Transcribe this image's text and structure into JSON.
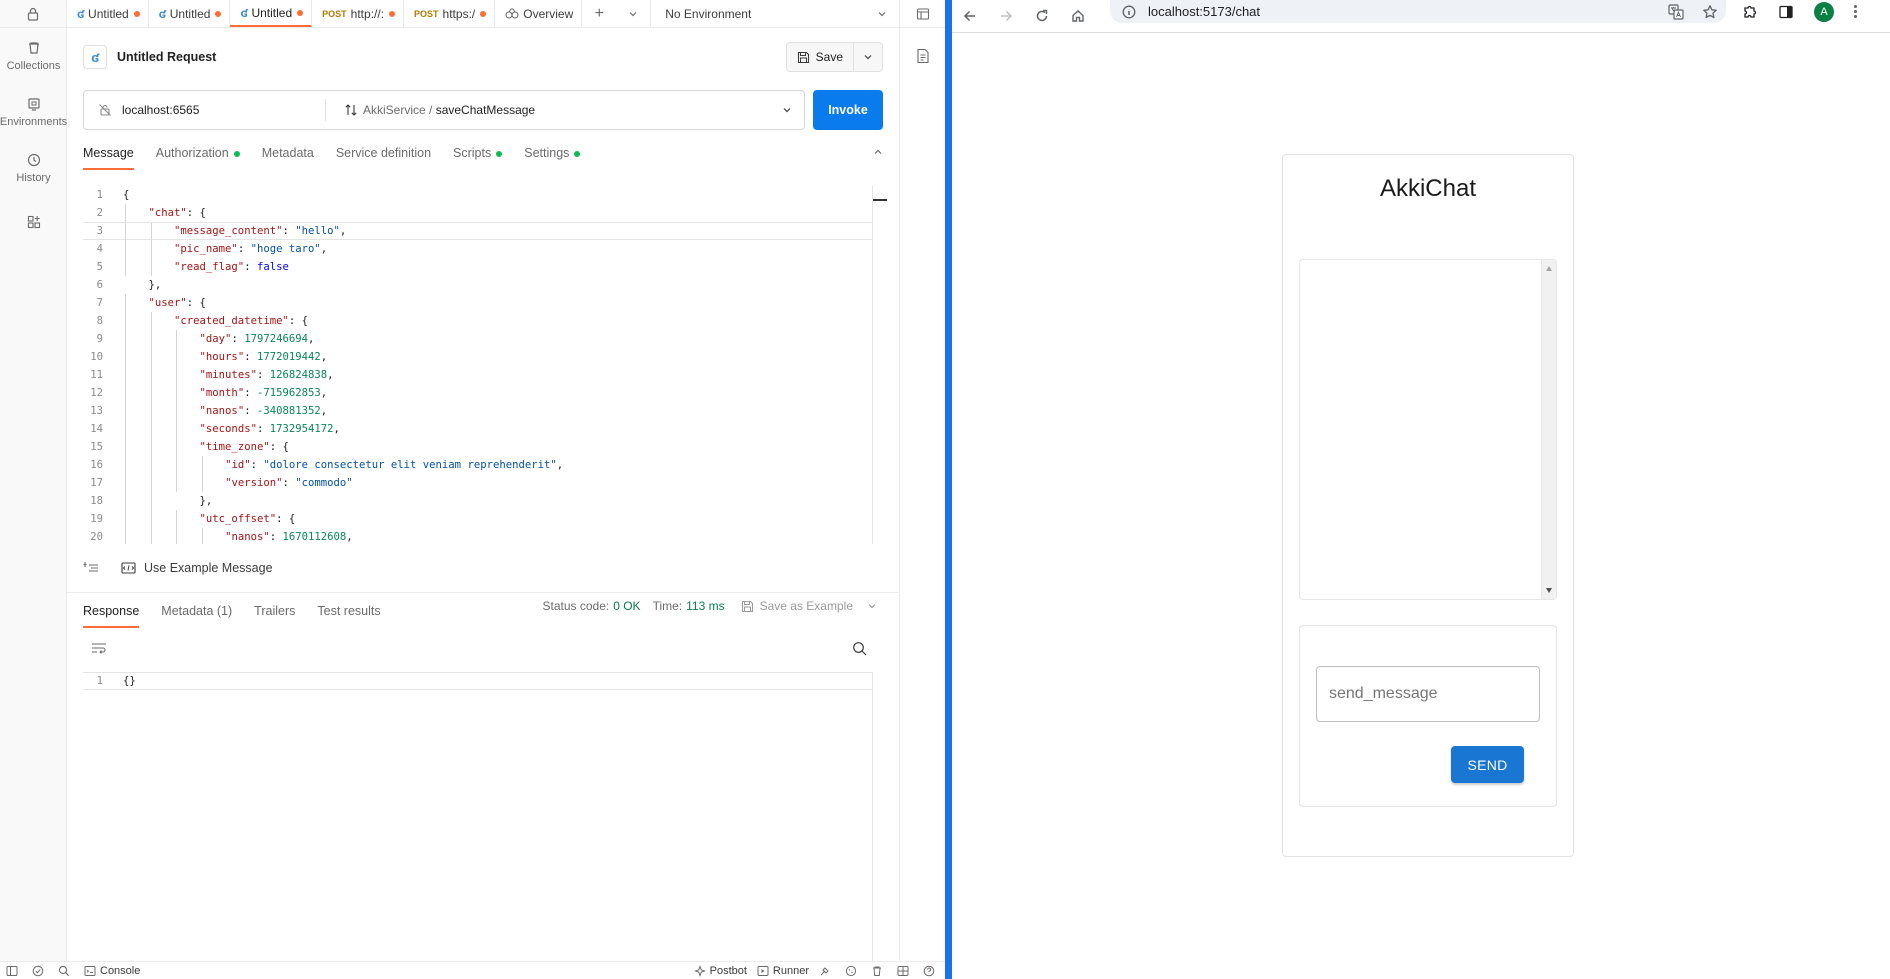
{
  "postman": {
    "rail": {
      "items": [
        {
          "label": "Collections",
          "icon": "trash-can-icon"
        },
        {
          "label": "Environments",
          "icon": "environment-icon"
        },
        {
          "label": "History",
          "icon": "history-icon"
        }
      ]
    },
    "tabs": [
      {
        "method": "",
        "label": "Untitled",
        "type": "grpc",
        "unsaved": true
      },
      {
        "method": "",
        "label": "Untitled",
        "type": "grpc",
        "unsaved": true
      },
      {
        "method": "",
        "label": "Untitled",
        "type": "grpc",
        "unsaved": true,
        "active": true
      },
      {
        "method": "POST",
        "label": "http://:",
        "type": "http",
        "unsaved": true
      },
      {
        "method": "POST",
        "label": "https:/",
        "type": "http",
        "unsaved": true
      },
      {
        "method": "",
        "label": "Overview",
        "type": "overview",
        "unsaved": false
      }
    ],
    "environment": "No Environment",
    "request": {
      "title": "Untitled Request",
      "save_label": "Save",
      "host": "localhost:6565",
      "service": "AkkiService",
      "separator": " / ",
      "method": "saveChatMessage",
      "invoke_label": "Invoke"
    },
    "request_tabs": [
      {
        "label": "Message",
        "active": true,
        "dot": false
      },
      {
        "label": "Authorization",
        "active": false,
        "dot": true
      },
      {
        "label": "Metadata",
        "active": false,
        "dot": false
      },
      {
        "label": "Service definition",
        "active": false,
        "dot": false
      },
      {
        "label": "Scripts",
        "active": false,
        "dot": true
      },
      {
        "label": "Settings",
        "active": false,
        "dot": true
      }
    ],
    "code_lines": [
      "{",
      "    \"chat\": {",
      "        \"message_content\": \"hello\",",
      "        \"pic_name\": \"hoge taro\",",
      "        \"read_flag\": false",
      "    },",
      "    \"user\": {",
      "        \"created_datetime\": {",
      "            \"day\": 1797246694,",
      "            \"hours\": 1772019442,",
      "            \"minutes\": 126824838,",
      "            \"month\": -715962853,",
      "            \"nanos\": -340881352,",
      "            \"seconds\": 1732954172,",
      "            \"time_zone\": {",
      "                \"id\": \"dolore consectetur elit veniam reprehenderit\",",
      "                \"version\": \"commodo\"",
      "            },",
      "            \"utc_offset\": {",
      "                \"nanos\": 1670112608,"
    ],
    "use_example_label": "Use Example Message",
    "response_tabs": [
      {
        "label": "Response",
        "active": true
      },
      {
        "label": "Metadata (1)",
        "active": false
      },
      {
        "label": "Trailers",
        "active": false
      },
      {
        "label": "Test results",
        "active": false
      }
    ],
    "status": {
      "status_label": "Status code:",
      "status_value": "0 OK",
      "time_label": "Time:",
      "time_value": "113 ms",
      "save_example_label": "Save as Example"
    },
    "response_lines": [
      "{}"
    ],
    "statusbar": {
      "console_label": "Console",
      "postbot_label": "Postbot",
      "runner_label": "Runner"
    }
  },
  "browser": {
    "url": "localhost:5173/chat",
    "avatar_letter": "A",
    "chat": {
      "title": "AkkiChat",
      "input_placeholder": "send_message",
      "send_label": "SEND"
    }
  },
  "colors": {
    "postman_accent": "#ff6c37",
    "invoke_blue": "#097bed",
    "status_green": "#097b47",
    "send_blue": "#1976d2",
    "pane_divider": "#1a73e8"
  }
}
